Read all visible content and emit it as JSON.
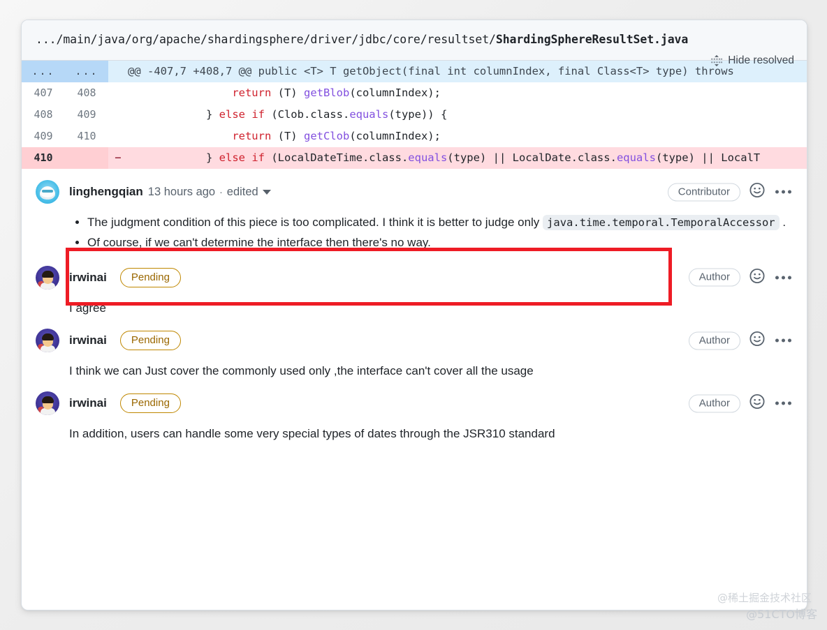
{
  "file": {
    "path_prefix": ".../main/java/org/apache/shardingsphere/driver/jdbc/core/resultset/",
    "path_file": "ShardingSphereResultSet.java",
    "hide_resolved_label": "Hide resolved",
    "fold_icon": "fold-icon"
  },
  "diff": {
    "rows": [
      {
        "type": "hunk",
        "old": "...",
        "new": "...",
        "marker": "",
        "code_plain": "@@ -407,7 +408,7 @@ public <T> T getObject(final int columnIndex, final Class<T> type) throws",
        "code_html": "@@ -407,7 +408,7 @@ public &lt;T&gt; T getObject(final int columnIndex, final Class&lt;T&gt; type) throws"
      },
      {
        "type": "ctx",
        "old": "407",
        "new": "408",
        "marker": "",
        "code_plain": "                return (T) getBlob(columnIndex);",
        "code_html": "                <span class=\"k-red\">return</span> (T) <span class=\"k-purple\">getBlob</span>(columnIndex);"
      },
      {
        "type": "ctx",
        "old": "408",
        "new": "409",
        "marker": "",
        "code_plain": "            } else if (Clob.class.equals(type)) {",
        "code_html": "            } <span class=\"k-red\">else if</span> (Clob.class.<span class=\"k-purple\">equals</span>(type)) {"
      },
      {
        "type": "ctx",
        "old": "409",
        "new": "410",
        "marker": "",
        "code_plain": "                return (T) getClob(columnIndex);",
        "code_html": "                <span class=\"k-red\">return</span> (T) <span class=\"k-purple\">getClob</span>(columnIndex);"
      },
      {
        "type": "del",
        "old": "410",
        "new": "",
        "marker": "−",
        "code_plain": "            } else if (LocalDateTime.class.equals(type) || LocalDate.class.equals(type) || LocalT",
        "code_html": "            } <span class=\"k-red\">else if</span> (LocalDateTime.class.<span class=\"k-purple\">equals</span>(type) || LocalDate.class.<span class=\"k-purple\">equals</span>(type) || LocalT"
      }
    ]
  },
  "threads": [
    {
      "author": "linghengqian",
      "avatar": "ling",
      "time": "13 hours ago",
      "dot": "·",
      "edited": "edited",
      "badge": "Contributor",
      "badge_kind": "contributor",
      "reaction_icon": "smiley-icon",
      "more_icon": "kebab-menu-icon",
      "bullets": [
        {
          "pre": "The judgment condition of this piece is too complicated. I think it is better to judge only ",
          "code": "java.time.temporal.TemporalAccessor",
          "post": " ."
        },
        {
          "pre": "Of course, if we can't determine the interface then there's no way.",
          "code": "",
          "post": ""
        }
      ],
      "text": ""
    },
    {
      "author": "irwinai",
      "avatar": "irwin",
      "time": "",
      "dot": "",
      "edited": "",
      "state_badge": "Pending",
      "badge": "Author",
      "badge_kind": "author",
      "reaction_icon": "smiley-icon",
      "more_icon": "kebab-menu-icon",
      "text": "I agree"
    },
    {
      "author": "irwinai",
      "avatar": "irwin",
      "time": "",
      "dot": "",
      "edited": "",
      "state_badge": "Pending",
      "badge": "Author",
      "badge_kind": "author",
      "reaction_icon": "smiley-icon",
      "more_icon": "kebab-menu-icon",
      "text": "I think we can Just cover the commonly used only ,the interface can't cover all the usage"
    },
    {
      "author": "irwinai",
      "avatar": "irwin",
      "time": "",
      "dot": "",
      "edited": "",
      "state_badge": "Pending",
      "badge": "Author",
      "badge_kind": "author",
      "reaction_icon": "smiley-icon",
      "more_icon": "kebab-menu-icon",
      "text": "In addition, users can handle some very special types of dates through the JSR310 standard"
    }
  ],
  "annotation": {
    "highlight_color": "#ee1c25"
  },
  "watermarks": {
    "primary": "@稀土掘金技术社区",
    "secondary": "@51CTO博客"
  }
}
